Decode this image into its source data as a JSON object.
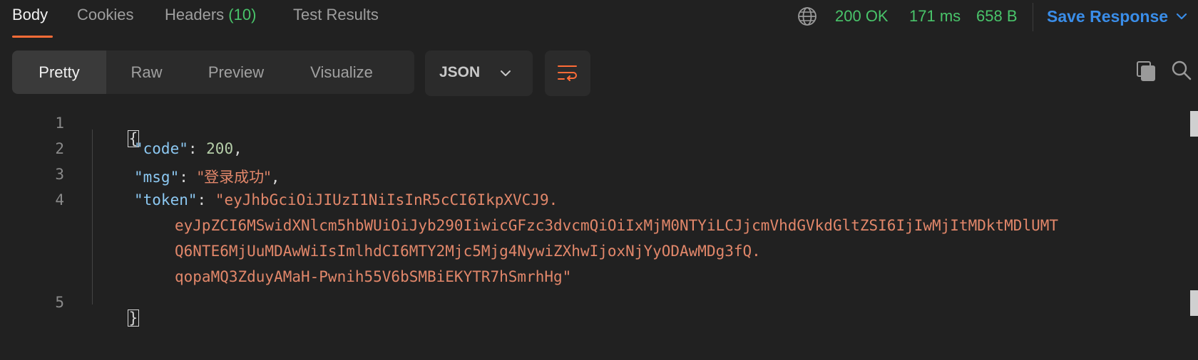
{
  "tabs": {
    "body": "Body",
    "cookies": "Cookies",
    "headers_label": "Headers",
    "headers_count": "(10)",
    "test_results": "Test Results"
  },
  "status": {
    "code": "200 OK",
    "time": "171 ms",
    "size": "658 B",
    "save_label": "Save Response"
  },
  "view_modes": [
    "Pretty",
    "Raw",
    "Preview",
    "Visualize"
  ],
  "format": "JSON",
  "code": {
    "line_numbers": [
      "1",
      "2",
      "3",
      "4",
      "5"
    ],
    "open_brace": "{",
    "close_brace": "}",
    "code_key": "\"code\"",
    "code_value": "200",
    "msg_key": "\"msg\"",
    "msg_value": "\"登录成功\"",
    "token_key": "\"token\"",
    "token_parts": [
      "\"eyJhbGciOiJIUzI1NiIsInR5cCI6IkpXVCJ9.",
      "eyJpZCI6MSwidXNlcm5hbWUiOiJyb290IiwicGFzc3dvcmQiOiIxMjM0NTYiLCJjcmVhdGVkdGltZSI6IjIwMjItMDktMDlUMT",
      "Q6NTE6MjUuMDAwWiIsImlhdCI6MTY2Mjc5Mjg4NywiZXhwIjoxNjYyODAwMDg3fQ.",
      "qopaMQ3ZduyAMaH-Pwnih55V6bSMBiEKYTR7hSmrhHg\""
    ]
  },
  "colors": {
    "accent": "#ff6c37",
    "success": "#49c46a",
    "link": "#3a8de8",
    "background": "#212121"
  },
  "icons": [
    "globe-icon",
    "chevron-down-icon",
    "wrap-lines-icon",
    "copy-icon",
    "search-icon"
  ]
}
